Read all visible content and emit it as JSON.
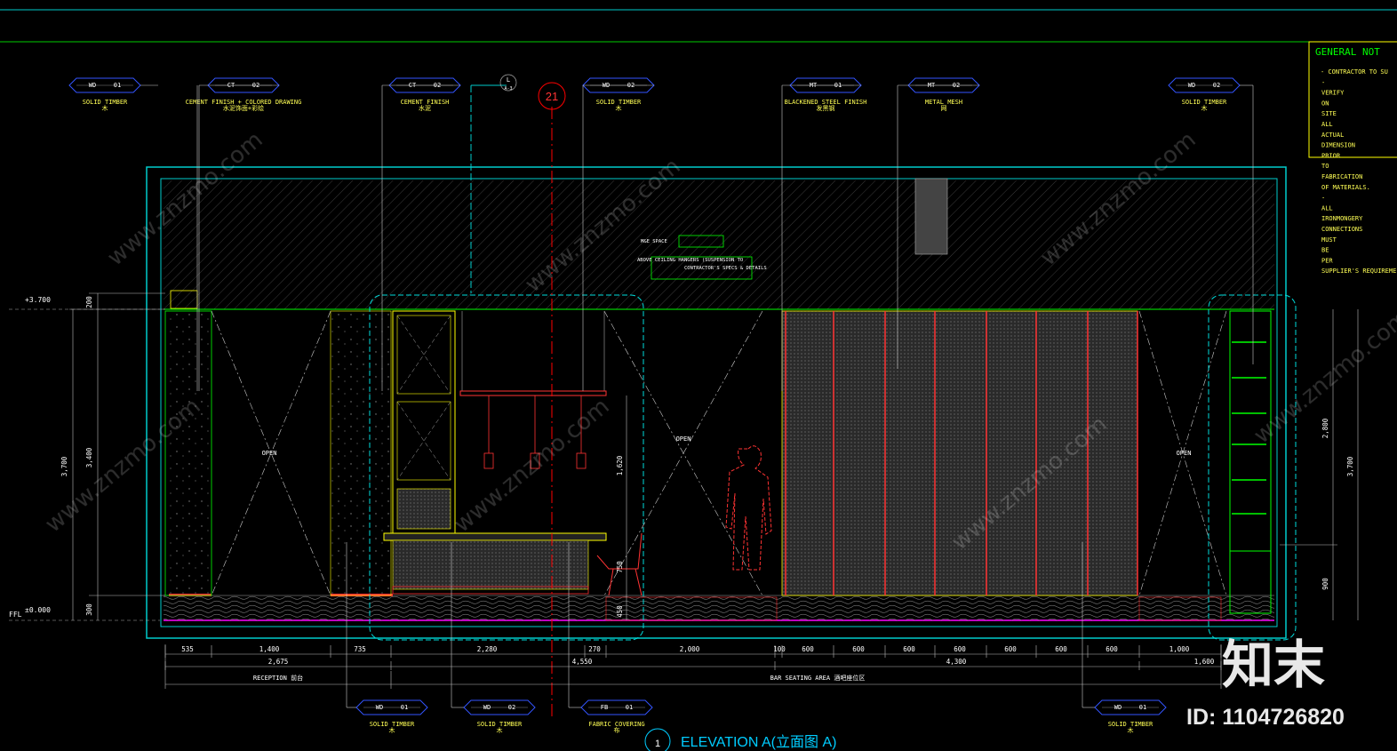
{
  "title": {
    "number": "1",
    "text": "ELEVATION A(立面图 A)"
  },
  "grid_marker": "21",
  "section_marker": {
    "top": "L",
    "bottom": "A-3"
  },
  "general_notes": {
    "heading": "GENERAL NOT",
    "lines": [
      "- CONTRACTOR TO SU",
      "-",
      "VERIFY",
      "ON",
      "SITE",
      "ALL",
      "ACTUAL",
      "DIMENSION",
      "PRIOR",
      "TO",
      "FABRICATION",
      "OF MATERIALS.",
      "-",
      "ALL",
      "IRONMONGERY",
      "CONNECTIONS",
      "MUST",
      "BE",
      "PER",
      "SUPPLIER'S REQUIREME"
    ]
  },
  "tags_top": [
    {
      "code": "WD",
      "num": "01",
      "label": "SOLID TIMBER",
      "sub": "木"
    },
    {
      "code": "CT",
      "num": "02",
      "label": "CEMENT FINISH + COLORED DRAWING",
      "sub": "水泥饰面+彩绘"
    },
    {
      "code": "CT",
      "num": "02",
      "label": "CEMENT FINISH",
      "sub": "水泥"
    },
    {
      "code": "WD",
      "num": "02",
      "label": "SOLID TIMBER",
      "sub": "木"
    },
    {
      "code": "MT",
      "num": "01",
      "label": "BLACKENED STEEL FINISH",
      "sub": "发黑钢"
    },
    {
      "code": "MT",
      "num": "02",
      "label": "METAL MESH",
      "sub": "网"
    },
    {
      "code": "WD",
      "num": "02",
      "label": "SOLID TIMBER",
      "sub": "木"
    }
  ],
  "tags_bottom": [
    {
      "code": "WD",
      "num": "01",
      "label": "SOLID TIMBER",
      "sub": "木"
    },
    {
      "code": "WD",
      "num": "02",
      "label": "SOLID TIMBER",
      "sub": "木"
    },
    {
      "code": "FB",
      "num": "01",
      "label": "FABRIC COVERING",
      "sub": "布"
    },
    {
      "code": "WD",
      "num": "01",
      "label": "SOLID TIMBER",
      "sub": "木"
    }
  ],
  "notes": {
    "mep": "M&E SPACE",
    "ceiling": "ABOVE CEILING HANGERS (SUSPENSION TO",
    "ceiling2": "CONTRACTOR'S SPECS & DETAILS"
  },
  "open_labels": [
    "OPEN",
    "OPEN",
    "OPEN"
  ],
  "levels": {
    "top": "+3.700",
    "ffl": "FFL",
    "ffl_val": "±0.000"
  },
  "dims_left": [
    "200",
    "3,400",
    "3,700",
    "300"
  ],
  "dims_right": [
    "2,800",
    "3,700",
    "900"
  ],
  "dims_mid": [
    "1,620",
    "750",
    "450"
  ],
  "dims_bottom_row1": [
    "535",
    "1,400",
    "735",
    "2,280",
    "270",
    "2,000",
    "100",
    "600",
    "600",
    "600",
    "600",
    "600",
    "600",
    "600",
    "1,000"
  ],
  "dims_bottom_row2": [
    "2,675",
    "4,550",
    "4,300",
    "1,600"
  ],
  "zones": [
    "RECEPTION 前台",
    "BAR SEATING AREA 酒吧座位区"
  ],
  "watermark": {
    "brand": "知末",
    "id": "ID: 1104726820",
    "site": "www.znzmo.com"
  }
}
